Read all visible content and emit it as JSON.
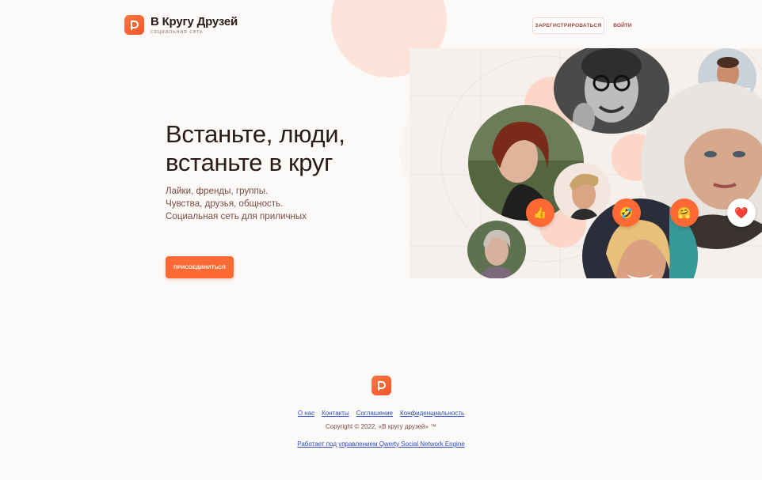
{
  "header": {
    "logo_title": "В Кругу Друзей",
    "logo_subtitle": "социальная сеть",
    "register_label": "ЗАРЕГИСТРИРОВАТЬСЯ",
    "login_label": "ВОЙТИ"
  },
  "hero": {
    "title_line1": "Встаньте, люди,",
    "title_line2": "встаньте в круг",
    "line1": "Лайки, френды, группы.",
    "line2": "Чувства, друзья, общность.",
    "line3": "Социальная сеть для приличных",
    "join_label": "ПРИСОЕДИНИТЬСЯ"
  },
  "collage": {
    "badges": [
      {
        "emoji": "👍",
        "icon": "thumbs-up-icon"
      },
      {
        "emoji": "🤣",
        "icon": "laughing-face-icon"
      },
      {
        "emoji": "🤗",
        "icon": "hugging-face-icon"
      },
      {
        "emoji": "❤️",
        "icon": "heart-icon"
      }
    ]
  },
  "footer": {
    "links": [
      "О нас",
      "Контакты",
      "Соглашение",
      "Конфиденциальность"
    ],
    "copyright": "Copyright © 2022, «В кругу друзей» ™",
    "powered_by": "Работает под управлением Qwerty Social Network Engine"
  },
  "colors": {
    "accent": "#ff6a34",
    "peach": "#fde3d9",
    "text_dark": "#2a1b17",
    "text_brown": "#7a4a40",
    "link": "#2c4db8"
  }
}
